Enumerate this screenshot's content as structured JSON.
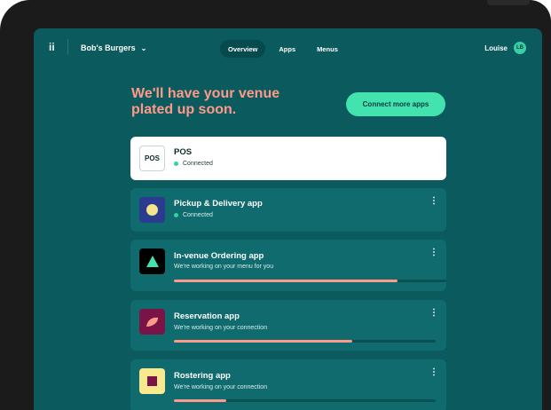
{
  "nav": {
    "logo": "ii",
    "venue": "Bob's Burgers",
    "venue_chevron": "⌄",
    "tabs": [
      {
        "label": "Overview",
        "active": true
      },
      {
        "label": "Apps",
        "active": false
      },
      {
        "label": "Menus",
        "active": false
      }
    ],
    "user_name": "Louise",
    "user_initials": "LB"
  },
  "headline": {
    "line1": "We'll have your venue",
    "line2": "plated up soon."
  },
  "cta_label": "Connect more apps",
  "apps": [
    {
      "icon": "pos-icon",
      "icon_text": "POS",
      "title": "POS",
      "status": "Connected",
      "connected": true
    },
    {
      "icon": "circle-icon",
      "title": "Pickup & Delivery app",
      "status": "Connected",
      "connected": true,
      "icon_bg": "#2b3b8f",
      "mark_color": "#f4e58a"
    },
    {
      "icon": "triangle-icon",
      "title": "In-venue Ordering app",
      "status": "We're working on your menu for you",
      "progress": 0.82,
      "icon_bg": "#000000",
      "mark_color": "#43e3b0"
    },
    {
      "icon": "leaf-icon",
      "title": "Reservation app",
      "status": "We're working on your connection",
      "progress": 0.68,
      "icon_bg": "#7a1447",
      "mark_color": "#ff9a8a"
    },
    {
      "icon": "square-icon",
      "title": "Rostering app",
      "status": "We're working on your connection",
      "progress": 0.2,
      "icon_bg": "#f7e98e",
      "mark_color": "#7a1447"
    }
  ],
  "kebab_glyph": "⋮",
  "colors": {
    "screen_bg": "#0b5a5d",
    "card_bg": "#0f6b6e",
    "accent": "#43e3b0",
    "headline": "#ff9a8a",
    "progress_fill": "#ff9a8a"
  }
}
